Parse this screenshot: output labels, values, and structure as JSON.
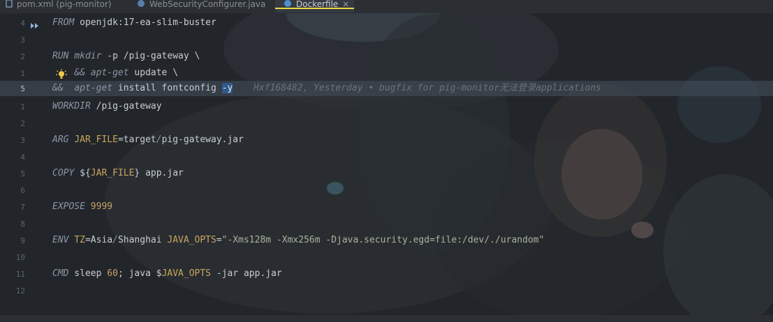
{
  "tabs": [
    {
      "label": "pom.xml (pig-monitor)",
      "icon": "file-icon"
    },
    {
      "label": "WebSecurityConfigurer.java",
      "icon": "java-class-icon"
    },
    {
      "label": "Dockerfile",
      "icon": "docker-icon",
      "active": true,
      "close": "×"
    }
  ],
  "gutter": [
    "4",
    "3",
    "2",
    "1",
    "5",
    "1",
    "2",
    "3",
    "4",
    "5",
    "6",
    "7",
    "8",
    "9",
    "10",
    "11",
    "12"
  ],
  "editor": {
    "l1": {
      "kw": "FROM",
      "rest": " openjdk:17-ea-slim-buster"
    },
    "l2": {
      "kw": "RUN",
      "a": " ",
      "cmd": "mkdir",
      "b": " -p /pig-gateway \\"
    },
    "l3": {
      "pre": "    ",
      "amp": "&&",
      "a": " ",
      "cmd": "apt-get",
      "b": " update \\"
    },
    "l4": {
      "amp": "&&",
      "a": "  ",
      "cmd": "apt-get",
      "b": " install fontconfig ",
      "sel": "-y"
    },
    "l5": {
      "kw": "WORKDIR",
      "rest": " /pig-gateway"
    },
    "l6": {
      "kw": "ARG",
      "a": " ",
      "var": "JAR_FILE",
      "b": "=target",
      "c": "/",
      "d": "pig-gateway.jar"
    },
    "l7": {
      "kw": "COPY",
      "a": " ${",
      "var": "JAR_FILE",
      "b": "} app.jar"
    },
    "l8": {
      "kw": "EXPOSE",
      "a": " ",
      "num": "9999"
    },
    "l9": {
      "kw": "ENV",
      "a": " ",
      "v1": "TZ",
      "b": "=Asia",
      "c": "/",
      "d": "Shanghai ",
      "v2": "JAVA_OPTS",
      "e": "=",
      "str": "\"-Xms128m -Xmx256m -Djava.security.egd=file:/dev/./urandom\""
    },
    "l10": {
      "kw": "CMD",
      "a": " sleep ",
      "num": "60",
      "b": "; java $",
      "var": "JAVA_OPTS",
      "c": " -jar app.jar"
    }
  },
  "blame": "Hxf168482, Yesterday • bugfix for pig-monitor无法登录applications",
  "colors": {
    "accent_tab": "#e6d642",
    "selection": "#2e5a88",
    "bulb": "#f2c94c",
    "run": "#8fb4d9"
  }
}
